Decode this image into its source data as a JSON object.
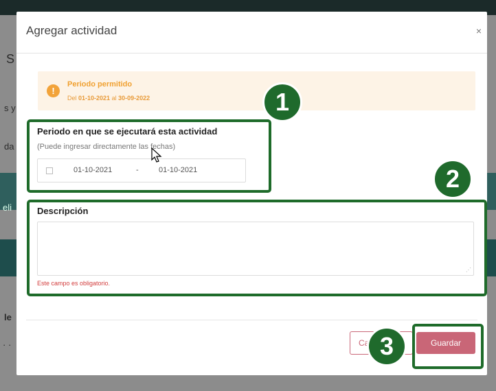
{
  "modal": {
    "title": "Agregar actividad",
    "close_glyph": "×"
  },
  "alert": {
    "icon": "!",
    "title": "Periodo permitido",
    "text_prefix": "Del ",
    "from": "01-10-2021",
    "text_mid": " al ",
    "to": "30-09-2022"
  },
  "periodo": {
    "label": "Periodo en que se ejecutará esta actividad",
    "hint": "(Puede ingresar directamente las fechas)",
    "start": "01-10-2021",
    "separator": "-",
    "end": "01-10-2021"
  },
  "descripcion": {
    "label": "Descripción",
    "value": "",
    "error": "Este campo es obligatorio."
  },
  "footer": {
    "cancel_label": "Ca",
    "save_label": "Guardar"
  },
  "background": {
    "frag_1": "S",
    "frag_2": "s y",
    "frag_3": "da",
    "frag_4": "eli",
    "frag_5": "le",
    "frag_6": "· ·"
  },
  "tutorial": {
    "step_1": "1",
    "step_2": "2",
    "step_3": "3"
  },
  "colors": {
    "accent": "#c96677",
    "highlight": "#1e6b2a",
    "warning": "#f2a33a"
  }
}
